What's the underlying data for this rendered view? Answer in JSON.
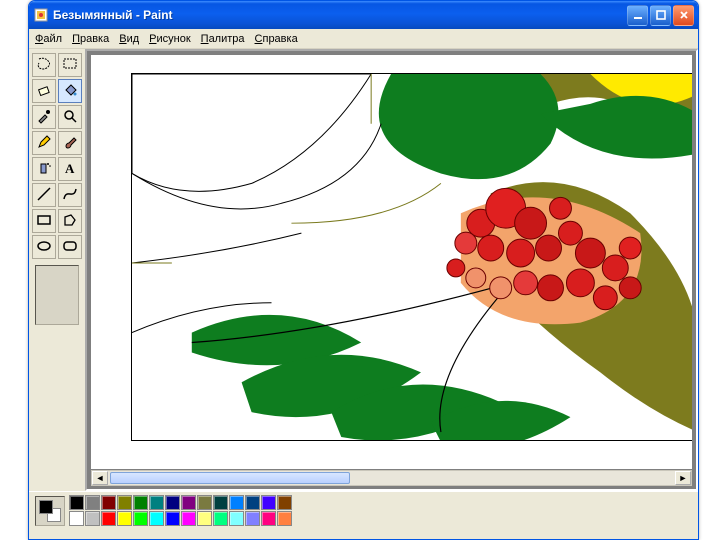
{
  "window": {
    "title": "Безымянный - Paint"
  },
  "menu": {
    "file": "Файл",
    "edit": "Правка",
    "view": "Вид",
    "image": "Рисунок",
    "colors": "Палитра",
    "help": "Справка"
  },
  "tools": [
    "free-select",
    "rect-select",
    "eraser",
    "fill",
    "picker",
    "magnifier",
    "pencil",
    "brush",
    "airbrush",
    "text",
    "line",
    "curve",
    "rectangle",
    "polygon",
    "ellipse",
    "rounded-rect"
  ],
  "active_tool": "fill",
  "colors": {
    "foreground": "#000000",
    "background": "#ffffff"
  },
  "palette": [
    "#000000",
    "#ffffff",
    "#808080",
    "#c0c0c0",
    "#800000",
    "#ff0000",
    "#808000",
    "#ffff00",
    "#008000",
    "#00ff00",
    "#008080",
    "#00ffff",
    "#000080",
    "#0000ff",
    "#800080",
    "#ff00ff",
    "#7a7a40",
    "#ffff80",
    "#004040",
    "#00ff80",
    "#0080ff",
    "#80ffff",
    "#004080",
    "#8080ff",
    "#4000ff",
    "#ff0080",
    "#804000",
    "#ff8040"
  ]
}
